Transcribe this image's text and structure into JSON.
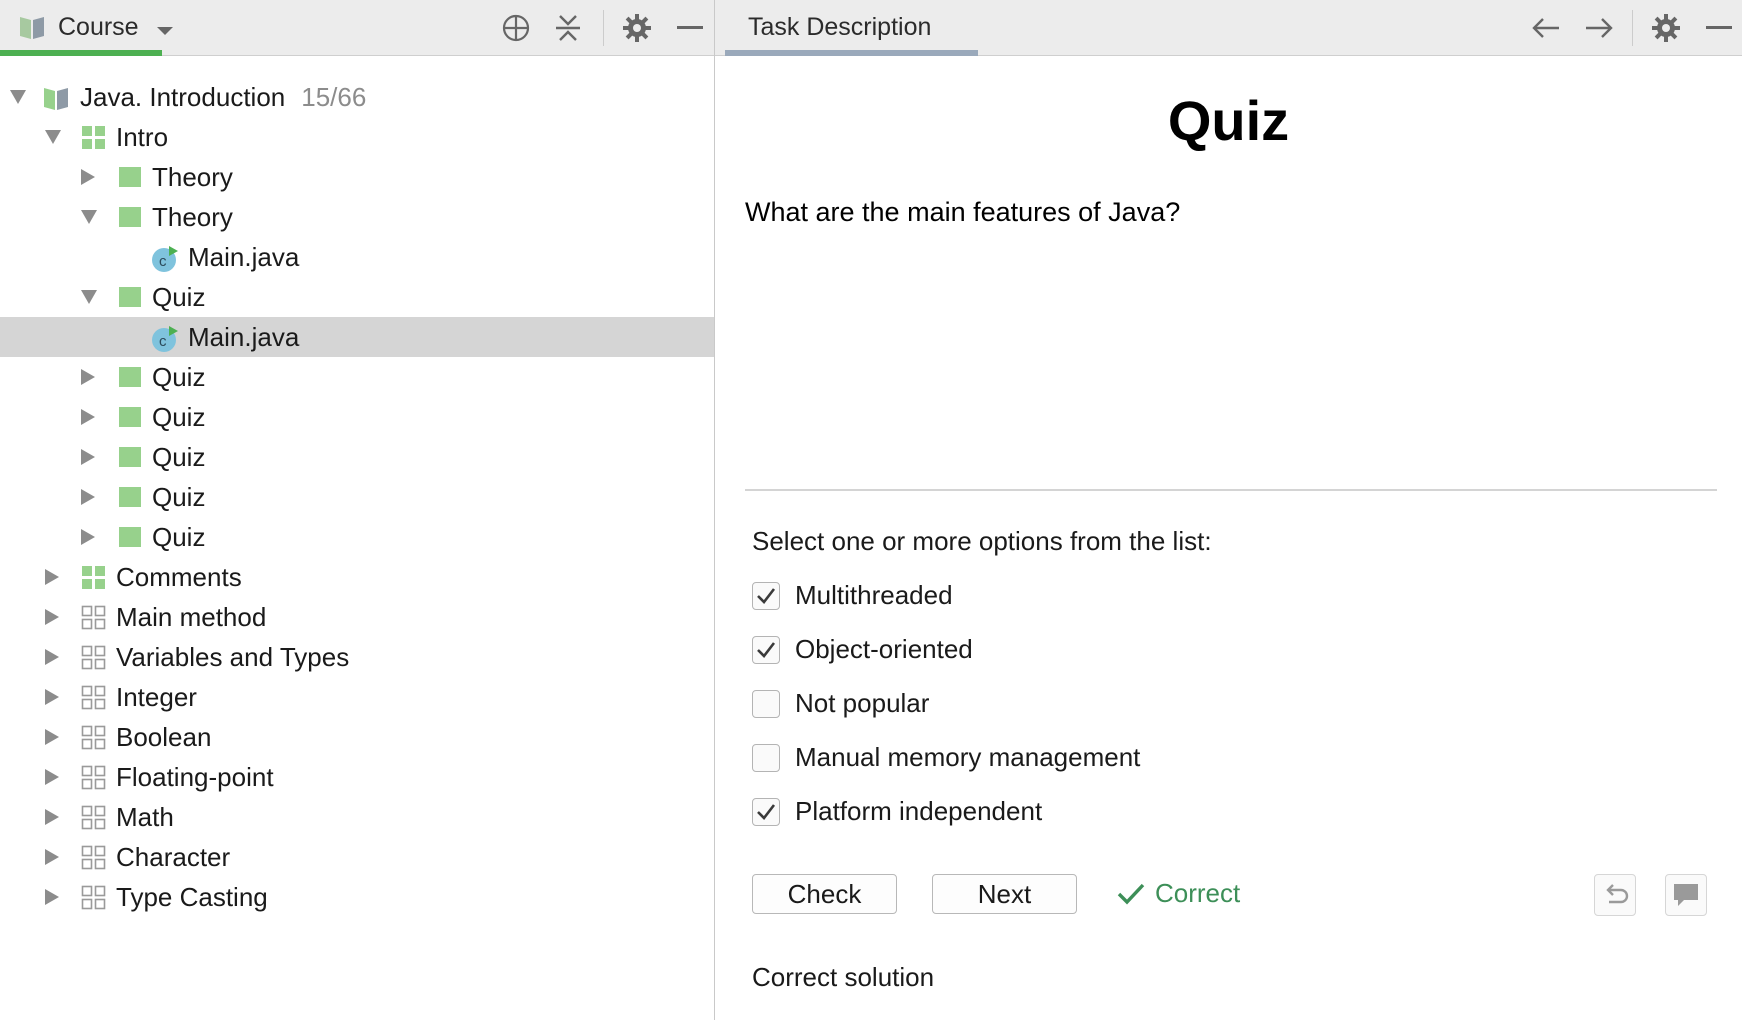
{
  "left_panel": {
    "title": "Course",
    "course": {
      "name": "Java. Introduction",
      "progress": "15/66"
    },
    "tree": [
      {
        "label": "Intro"
      },
      {
        "label": "Theory"
      },
      {
        "label": "Theory"
      },
      {
        "label": "Main.java"
      },
      {
        "label": "Quiz"
      },
      {
        "label": "Main.java"
      },
      {
        "label": "Quiz"
      },
      {
        "label": "Quiz"
      },
      {
        "label": "Quiz"
      },
      {
        "label": "Quiz"
      },
      {
        "label": "Quiz"
      },
      {
        "label": "Comments"
      },
      {
        "label": "Main method"
      },
      {
        "label": "Variables and Types"
      },
      {
        "label": "Integer"
      },
      {
        "label": "Boolean"
      },
      {
        "label": "Floating-point"
      },
      {
        "label": "Math"
      },
      {
        "label": "Character"
      },
      {
        "label": "Type Casting"
      }
    ]
  },
  "right_panel": {
    "tab_title": "Task Description",
    "quiz_title": "Quiz",
    "question": "What are the main features of Java?",
    "instruction": "Select one or more options from the list:",
    "options": [
      {
        "label": "Multithreaded",
        "checked": true
      },
      {
        "label": "Object-oriented",
        "checked": true
      },
      {
        "label": "Not popular",
        "checked": false
      },
      {
        "label": "Manual memory management",
        "checked": false
      },
      {
        "label": "Platform independent",
        "checked": true
      }
    ],
    "check_label": "Check",
    "next_label": "Next",
    "status_label": "Correct",
    "correct_solution_label": "Correct solution"
  },
  "colors": {
    "accent_green": "#3d8f58",
    "lesson_green": "#97d18c",
    "toolbar_bg": "#ececec",
    "selected_row": "#d5d5d5",
    "tab_underline_left": "#4db052",
    "tab_underline_right": "#9aa9bb"
  },
  "icons": {
    "course": "book-icon",
    "locate": "crosshair-icon",
    "collapse": "collapse-all-icon",
    "settings": "gear-icon",
    "hide": "minimize-icon",
    "back": "arrow-left-icon",
    "forward": "arrow-right-icon",
    "reset": "undo-icon",
    "comment": "comment-icon",
    "status": "check-icon"
  }
}
